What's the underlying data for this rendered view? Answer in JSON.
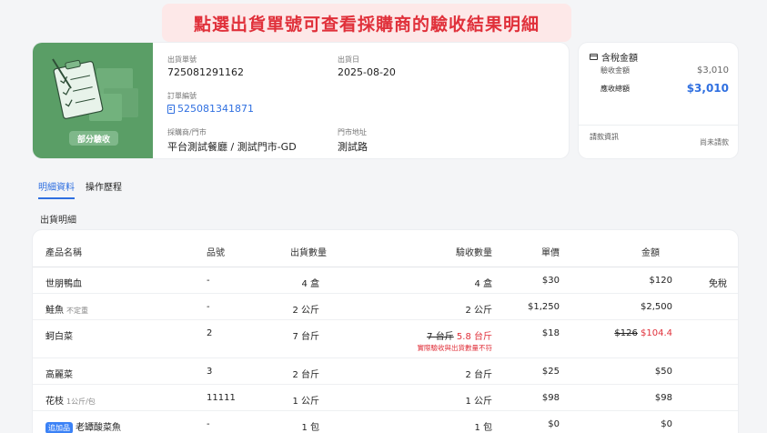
{
  "banner": "點選出貨單號可查看採購商的驗收結果明細",
  "order": {
    "status_badge": "部分驗收",
    "shipment_no_label": "出貨單號",
    "shipment_no": "725081291162",
    "ship_date_label": "出貨日",
    "ship_date": "2025-08-20",
    "order_no_label": "訂單編號",
    "order_no": "525081341871",
    "buyer_label": "採購商/門市",
    "buyer": "平台測試餐廳 / 測試門市-GD",
    "address_label": "門市地址",
    "address": "測試路"
  },
  "amount": {
    "title": "含稅金額",
    "accepted_label": "驗收金額",
    "accepted": "$3,010",
    "receivable_label": "應收總額",
    "receivable": "$3,010",
    "invoice_label": "請款資訊",
    "invoice_status": "尚未請款"
  },
  "tabs": [
    "明細資料",
    "操作歷程"
  ],
  "section_title": "出貨明細",
  "table": {
    "headers": [
      "產品名稱",
      "品號",
      "出貨數量",
      "驗收數量",
      "單價",
      "金額"
    ],
    "rows": [
      {
        "name": "世朋鴨血",
        "tag": "",
        "prefix": "",
        "sku": "-",
        "ship_qty": "4 盒",
        "accept_old": "",
        "accept_qty": "4 盒",
        "warning": "",
        "price": "$30",
        "amount_old": "",
        "amount": "$120",
        "note": "免稅"
      },
      {
        "name": "鮭魚",
        "tag": "不定重",
        "prefix": "",
        "sku": "-",
        "ship_qty": "2 公斤",
        "accept_old": "",
        "accept_qty": "2 公斤",
        "warning": "",
        "price": "$1,250",
        "amount_old": "",
        "amount": "$2,500",
        "note": ""
      },
      {
        "name": "蚵白菜",
        "tag": "",
        "prefix": "",
        "sku": "2",
        "ship_qty": "7 台斤",
        "accept_old": "7 台斤",
        "accept_qty": "5.8 台斤",
        "warning": "實際驗收與出貨數量不符",
        "price": "$18",
        "amount_old": "$126",
        "amount": "$104.4",
        "note": ""
      },
      {
        "name": "高麗菜",
        "tag": "",
        "prefix": "",
        "sku": "3",
        "ship_qty": "2 台斤",
        "accept_old": "",
        "accept_qty": "2 台斤",
        "warning": "",
        "price": "$25",
        "amount_old": "",
        "amount": "$50",
        "note": ""
      },
      {
        "name": "花枝",
        "tag": "1公斤/包",
        "prefix": "",
        "sku": "11111",
        "ship_qty": "1 公斤",
        "accept_old": "",
        "accept_qty": "1 公斤",
        "warning": "",
        "price": "$98",
        "amount_old": "",
        "amount": "$98",
        "note": ""
      },
      {
        "name": "老罈酸菜魚",
        "tag": "",
        "prefix": "追加品",
        "sku": "-",
        "ship_qty": "1 包",
        "accept_old": "",
        "accept_qty": "1 包",
        "warning": "",
        "price": "$0",
        "amount_old": "",
        "amount": "$0",
        "note": ""
      }
    ]
  }
}
